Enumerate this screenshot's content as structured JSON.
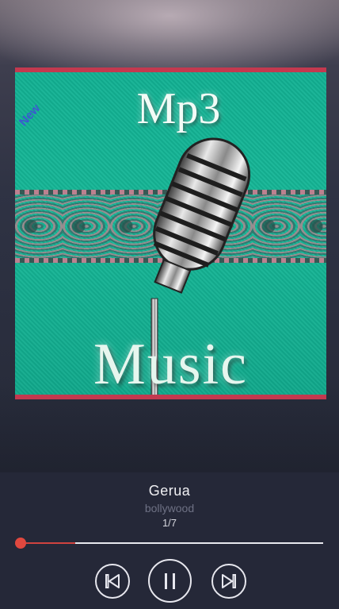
{
  "cover": {
    "title": "Mp3",
    "subtitle": "Music",
    "badge": "New"
  },
  "track": {
    "title": "Gerua",
    "album": "bollywood",
    "position": "1/7"
  },
  "playback": {
    "progress": 0.18,
    "state": "playing"
  },
  "controls": {
    "previous_icon": "skip-previous-icon",
    "play_pause_icon": "pause-icon",
    "next_icon": "skip-next-icon"
  },
  "colors": {
    "accent": "#d0433f",
    "cover_border": "#c3394f",
    "cover_bg": "#12b193",
    "panel_bg": "#252838"
  }
}
